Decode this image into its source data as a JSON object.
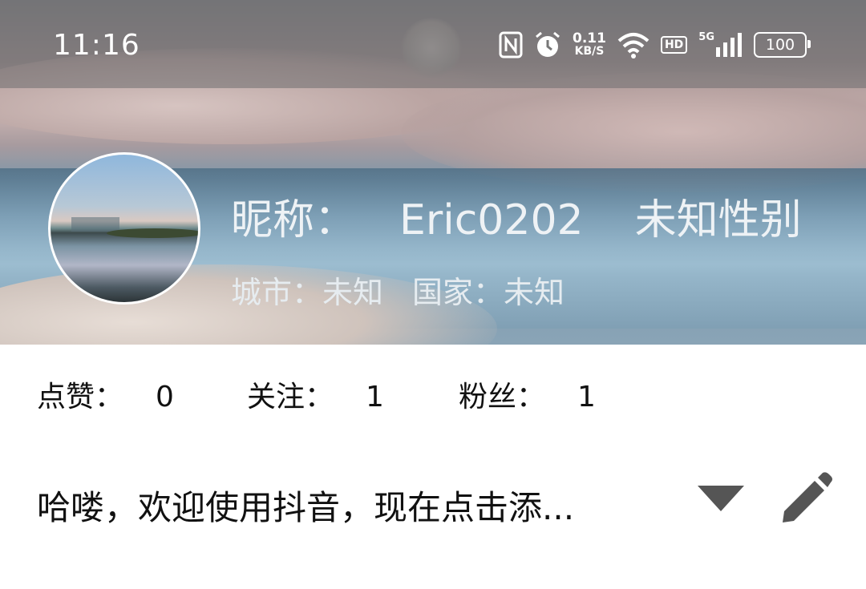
{
  "status_bar": {
    "time": "11:16",
    "net_speed_value": "0.11",
    "net_speed_unit": "KB/S",
    "hd_label": "HD",
    "network_label": "5G",
    "battery": "100",
    "icons": [
      "nfc-icon",
      "alarm-icon",
      "wifi-icon",
      "signal-icon",
      "battery-icon"
    ]
  },
  "profile": {
    "nickname_label": "昵称：",
    "nickname": "Eric0202",
    "gender": "未知性别",
    "city_label": "城市：",
    "city": "未知",
    "country_label": "国家：",
    "country": "未知"
  },
  "stats": {
    "likes_label": "点赞：",
    "likes": "0",
    "following_label": "关注：",
    "following": "1",
    "followers_label": "粉丝：",
    "followers": "1"
  },
  "bio": {
    "text": "哈喽，欢迎使用抖音，现在点击添..."
  },
  "colors": {
    "text_dark": "#111111",
    "header_text": "#eef2f5",
    "icon_gray": "#555555"
  }
}
